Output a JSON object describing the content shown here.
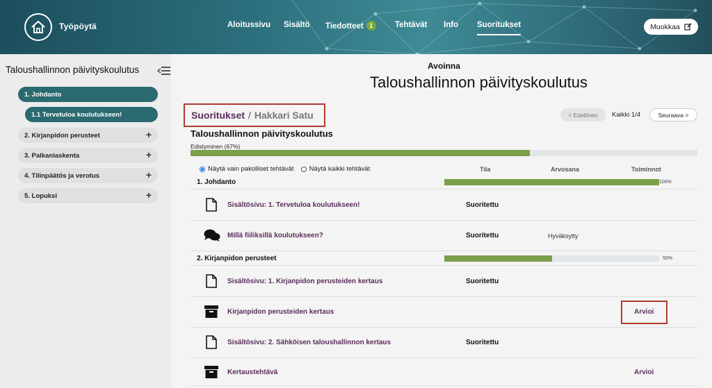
{
  "header": {
    "brand": "Työpöytä",
    "nav": [
      {
        "label": "Aloitussivu",
        "active": false
      },
      {
        "label": "Sisältö",
        "active": false
      },
      {
        "label": "Tiedotteet",
        "badge": "1",
        "active": false
      },
      {
        "label": "Tehtävät",
        "active": false
      },
      {
        "label": "Info",
        "active": false
      },
      {
        "label": "Suoritukset",
        "active": true
      }
    ],
    "edit_label": "Muokkaa"
  },
  "sidebar": {
    "title": "Taloushallinnon päivityskoulutus",
    "items": [
      {
        "label": "1. Johdanto",
        "active": true
      },
      {
        "label": "1.1 Tervetuloa koulutukseen!",
        "active": true
      },
      {
        "label": "2. Kirjanpidon perusteet",
        "expand": "+"
      },
      {
        "label": "3. Palkanlaskenta",
        "expand": "+"
      },
      {
        "label": "4. Tilinpäätös ja verotus",
        "expand": "+"
      },
      {
        "label": "5. Lopuksi",
        "expand": "+"
      }
    ]
  },
  "main": {
    "status": "Avoinna",
    "title": "Taloushallinnon päivityskoulutus",
    "breadcrumb": {
      "first": "Suoritukset",
      "separator": "/",
      "second": "Hakkari Satu"
    },
    "pager": {
      "prev": "< Edellinen",
      "counter": "Kaikki 1/4",
      "next": "Seuraava >"
    },
    "course_title": "Taloushallinnon päivityskoulutus",
    "progress_label": "Edistyminen (67%)",
    "progress": 67,
    "filters": {
      "required_only": "Näytä vain pakolliset tehtävät",
      "all_tasks": "Näytä kaikki tehtävät"
    },
    "columns": {
      "status": "Tila",
      "grade": "Arvosana",
      "actions": "Toiminnot"
    },
    "sections": [
      {
        "label": "1. Johdanto",
        "progress": 100,
        "progress_text": "100%"
      },
      {
        "label": "2. Kirjanpidon perusteet",
        "progress": 50,
        "progress_text": "50%"
      }
    ],
    "rows": [
      {
        "icon": "document-icon",
        "title": "Sisältösivu: 1. Tervetuloa koulutukseen!",
        "status": "Suoritettu",
        "grade": "",
        "action": ""
      },
      {
        "icon": "chat-bubbles-icon",
        "title": "Millä fiiliksillä koulutukseen?",
        "status": "Suoritettu",
        "grade": "Hyväksytty",
        "action": ""
      },
      {
        "icon": "document-icon",
        "title": "Sisältösivu: 1. Kirjanpidon perusteiden kertaus",
        "status": "Suoritettu",
        "grade": "",
        "action": ""
      },
      {
        "icon": "archive-box-icon",
        "title": "Kirjanpidon perusteiden kertaus",
        "status": "",
        "grade": "",
        "action": "Arvioi"
      },
      {
        "icon": "document-icon",
        "title": "Sisältösivu: 2. Sähköisen taloushallinnon kertaus",
        "status": "Suoritettu",
        "grade": "",
        "action": ""
      },
      {
        "icon": "archive-box-icon",
        "title": "Kertaustehtävä",
        "status": "",
        "grade": "",
        "action": "Arvioi"
      }
    ]
  },
  "colors": {
    "header": "#2c6f7c",
    "accent_teal": "#2a6a70",
    "progress_green": "#7a9f48",
    "title_purple": "#5a2d5c",
    "highlight_red": "#b03a2e"
  }
}
